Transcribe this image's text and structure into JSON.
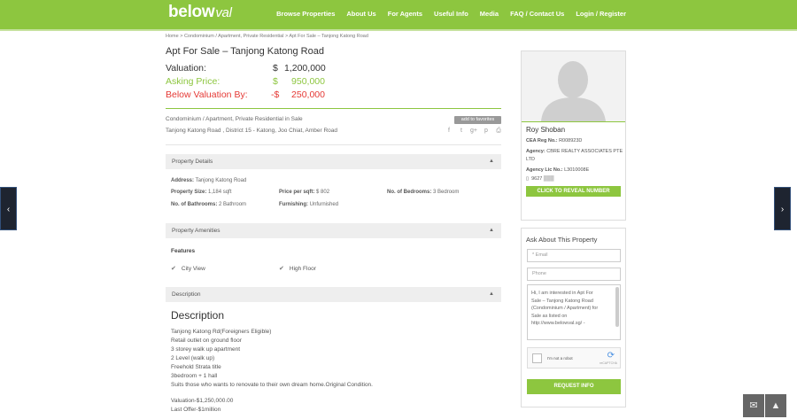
{
  "brand": {
    "logo_main": "below",
    "logo_accent": "val"
  },
  "nav": [
    "Browse Properties",
    "About Us",
    "For Agents",
    "Useful Info",
    "Media",
    "FAQ / Contact Us",
    "Login / Register"
  ],
  "breadcrumb": "Home > Condominium / Apartment, Private Residential > Apt For Sale – Tanjong Katong Road",
  "listing": {
    "title": "Apt For Sale – Tanjong Katong Road",
    "valuation": {
      "label": "Valuation:",
      "currency": "$",
      "amount": "1,200,000",
      "color": "#333333"
    },
    "asking": {
      "label": "Asking Price:",
      "currency": "$",
      "amount": "950,000",
      "color": "#8dc63f"
    },
    "below": {
      "label": "Below Valuation By:",
      "currency": "-$",
      "amount": "250,000",
      "color": "#e53935"
    },
    "type": "Condominium / Apartment, Private Residential in Sale",
    "address_line": "Tanjong Katong Road , District 15 - Katong, Joo Chiat, Amber Road",
    "favorites_label": "add to favorites",
    "share_icons": [
      "facebook-icon",
      "twitter-icon",
      "google-plus-icon",
      "pinterest-icon",
      "print-icon"
    ]
  },
  "details": {
    "header": "Property Details",
    "address_label": "Address:",
    "address_value": "Tanjong Katong Road",
    "size_label": "Property Size:",
    "size_value": "1,184 sqft",
    "psf_label": "Price per sqft:",
    "psf_value": "$ 802",
    "bedrooms_label": "No. of Bedrooms:",
    "bedrooms_value": "3 Bedroom",
    "bathrooms_label": "No. of Bathrooms:",
    "bathrooms_value": "2 Bathroom",
    "furnishing_label": "Furnishing:",
    "furnishing_value": "Unfurnished"
  },
  "amenities": {
    "header": "Property Amenities",
    "features_title": "Features",
    "items": [
      "City View",
      "High Floor"
    ]
  },
  "description": {
    "header": "Description",
    "heading": "Description",
    "lines": [
      "Tanjong Katong Rd(Foreigners Eligible)",
      "Retail outlet on ground floor",
      "3 storey walk up apartment",
      "2 Level (walk up)",
      "Freehold Strata title",
      "3bedroom + 1 hall",
      "Suits those who wants to renovate to their own dream home.Original Condition.",
      "",
      "Valuation-$1,250,000.00",
      "Last Offer-$1million"
    ]
  },
  "agent": {
    "name": "Roy Shoban",
    "cea_label": "CEA Reg No.:",
    "cea_value": "R008923D",
    "agency_label": "Agency:",
    "agency_value": "CBRE REALTY ASSOCIATES PTE",
    "agency_value2": "LTD",
    "lic_label": "Agency Lic No.:",
    "lic_value": "L3010008E",
    "phone_partial": "9627",
    "reveal_label": "CLICK TO REVEAL NUMBER"
  },
  "inquiry": {
    "title": "Ask About This Property",
    "email_placeholder": "* Email",
    "phone_placeholder": "Phone",
    "message_lines": [
      "Hi, I am interested in Apt For",
      "Sale – Tanjong Katong Road",
      "(Condominium / Apartment) for",
      "Sale as listed on",
      "http://www.belowval.sg/ -"
    ],
    "captcha_label": "I'm not a robot",
    "captcha_brand": "reCAPTCHA",
    "submit_label": "REQUEST INFO"
  },
  "colors": {
    "accent": "#8dc63f",
    "below_red": "#e53935",
    "side_arrow": "#1e2430"
  }
}
